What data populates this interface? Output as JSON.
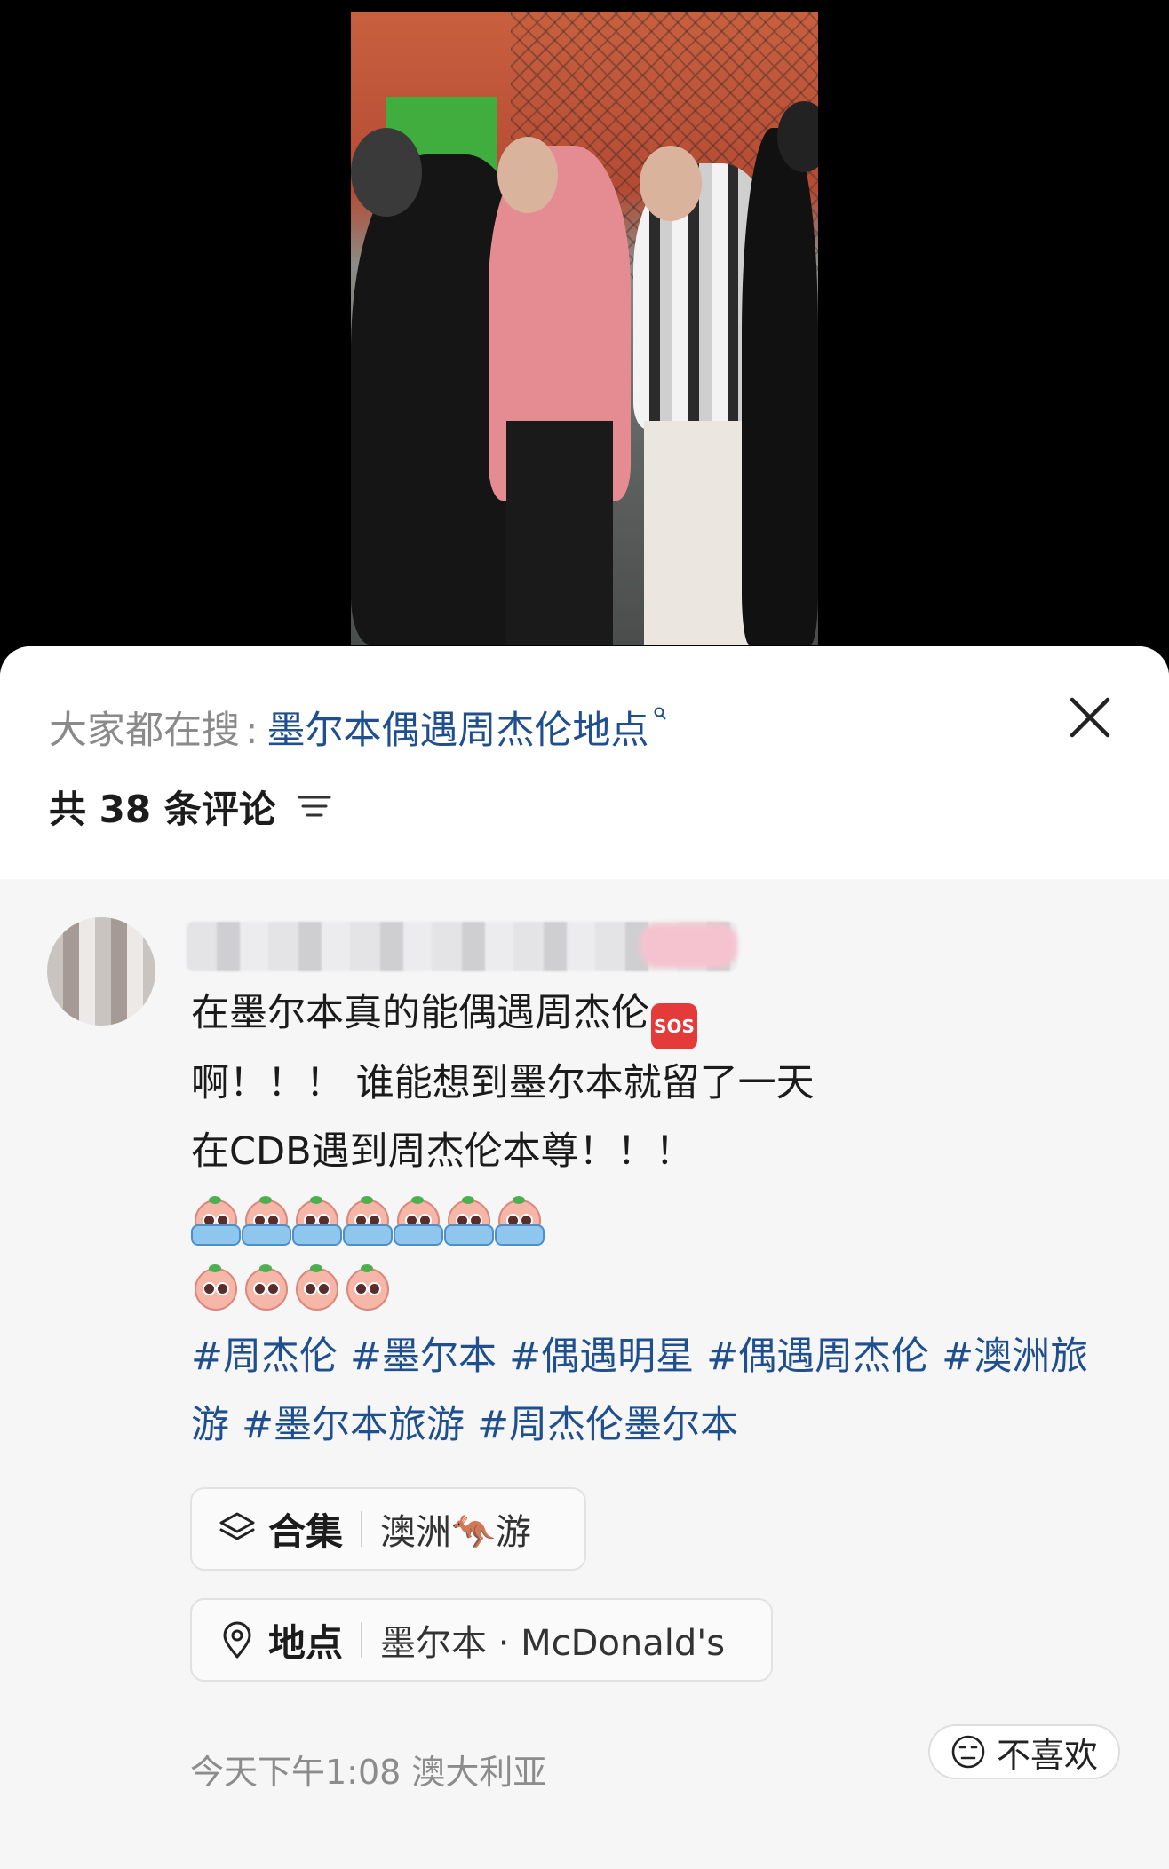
{
  "search": {
    "prefix": "大家都在搜",
    "colon": ":",
    "term": "墨尔本偶遇周杰伦地点"
  },
  "comments_header": {
    "count_label": "共 38 条评论"
  },
  "post": {
    "lines": [
      "在墨尔本真的能偶遇周杰伦",
      "啊！！！ 谁能想到墨尔本就留了一天",
      "在CDB遇到周杰伦本尊！！！"
    ],
    "sos_badge": "SOS",
    "tags": [
      "#周杰伦",
      "#墨尔本",
      "#偶遇明星",
      "#偶遇周杰伦",
      "#澳洲旅游",
      "#墨尔本旅游",
      "#周杰伦墨尔本"
    ],
    "collection": {
      "title": "合集",
      "value": "澳洲🦘游"
    },
    "location": {
      "title": "地点",
      "value": "墨尔本 · McDonald's"
    },
    "meta": "今天下午1:08 澳大利亚",
    "dislike_label": "不喜欢"
  },
  "colors": {
    "link": "#1f4f8f",
    "muted": "#8a8a8a"
  },
  "icons": [
    "close-icon",
    "sort-icon",
    "layers-icon",
    "location-pin-icon",
    "neutral-face-icon",
    "search-icon"
  ]
}
